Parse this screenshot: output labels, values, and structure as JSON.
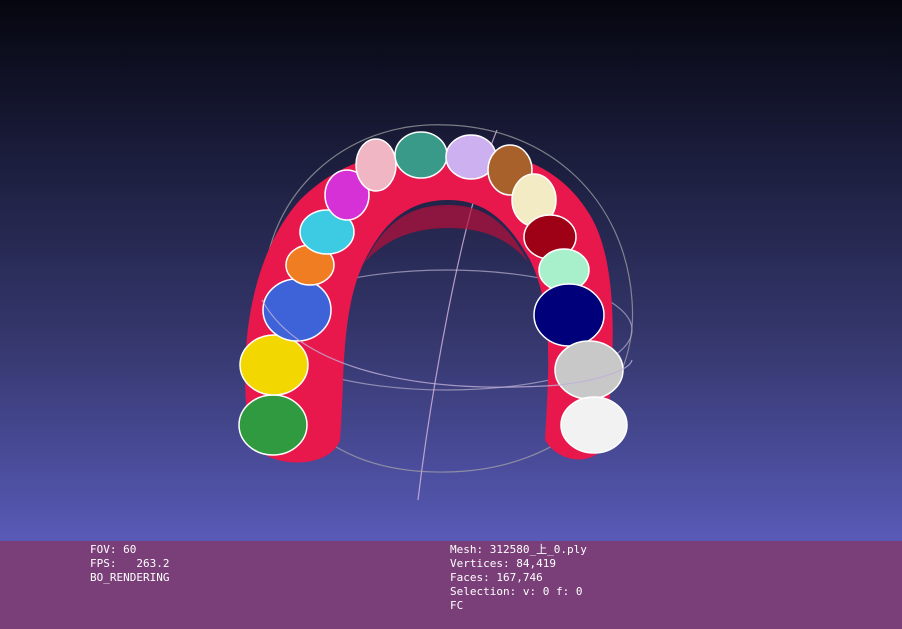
{
  "viewer": {
    "colors": {
      "background_top": "#05060f",
      "background_bottom": "#6a6dd6",
      "gum": "#e8184c",
      "info_panel": "#7a3f78",
      "trackball": "#a8a8a8"
    },
    "model": "dental arch mesh with segmented teeth",
    "teeth_colors": [
      "#2f9a3f",
      "#f2d800",
      "#3e63d8",
      "#f07d22",
      "#3ccbe2",
      "#d531d6",
      "#f0b6c3",
      "#3a9a8a",
      "#cdb0ef",
      "#a8612a",
      "#f2ebc4",
      "#9e0016",
      "#a8f0cc",
      "#00007a",
      "#c8c8c8",
      "#f2f2f2"
    ]
  },
  "info": {
    "left": {
      "fov": "FOV: 60",
      "fps": "FPS:   263.2",
      "mode": "BO_RENDERING"
    },
    "right": {
      "mesh": "Mesh: 312580_上_0.ply",
      "vertices": "Vertices: 84,419",
      "faces": "Faces: 167,746",
      "selection": "Selection: v: 0 f: 0",
      "flags": "FC"
    }
  }
}
